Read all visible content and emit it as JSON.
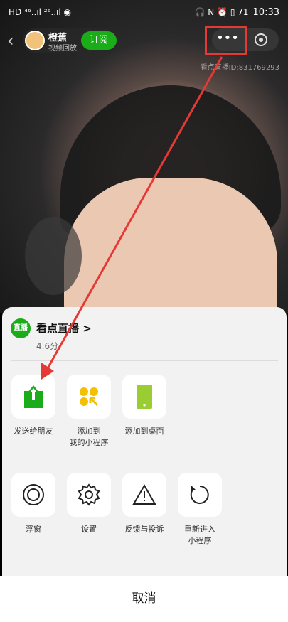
{
  "status_bar": {
    "left_icons": "HD ⁴⁶..ıl ²⁶..ıl ◉",
    "right_icons": "🎧 N ⏰ ▯ 71",
    "time": "10:33"
  },
  "top_bar": {
    "channel_name": "橙蕉",
    "channel_sub": "视频回放",
    "subscribe_label": "订阅",
    "more_icon": "more-dots-icon",
    "close_icon": "target-close-icon",
    "live_id": "看点直播ID:831769293"
  },
  "sheet": {
    "app_logo_text": "直播",
    "app_name": "看点直播 >",
    "app_rating": "4.6分",
    "row1": [
      {
        "label": "发送给朋友",
        "icon": "share-upload-icon"
      },
      {
        "label": "添加到\n我的小程序",
        "icon": "mini-program-icon"
      },
      {
        "label": "添加到桌面",
        "icon": "add-desktop-icon"
      }
    ],
    "row2": [
      {
        "label": "浮窗",
        "icon": "float-window-icon"
      },
      {
        "label": "设置",
        "icon": "settings-gear-icon"
      },
      {
        "label": "反馈与投诉",
        "icon": "warning-icon"
      },
      {
        "label": "重新进入\n小程序",
        "icon": "reload-icon"
      }
    ]
  },
  "cancel_label": "取消",
  "colors": {
    "accent_green": "#1aad19",
    "annotation_red": "#e53935",
    "mini_yellow": "#f5c000",
    "desktop_lime": "#9acd32"
  }
}
